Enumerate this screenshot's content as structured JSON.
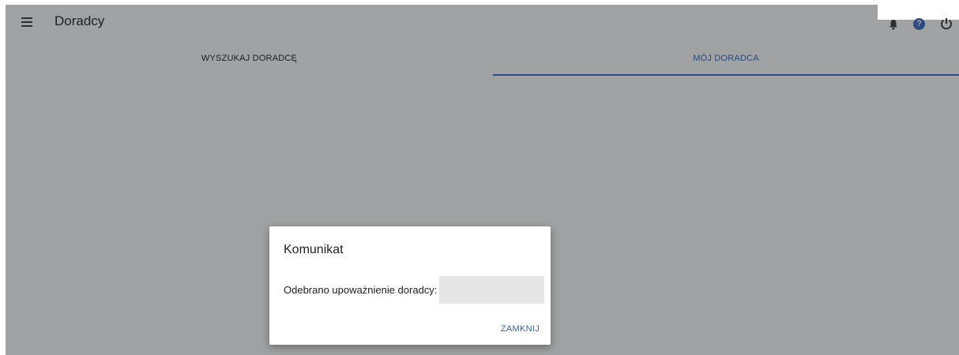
{
  "appbar": {
    "title": "Doradcy",
    "icons": [
      "menu-icon",
      "bell-icon",
      "help-icon",
      "power-icon"
    ]
  },
  "tabs": [
    {
      "label": "WYSZUKAJ DORADCĘ",
      "active": false
    },
    {
      "label": "MÓJ DORADCA",
      "active": true
    }
  ],
  "dialog": {
    "title": "Komunikat",
    "message": "Odebrano upoważnienie doradcy:",
    "value": "",
    "close_label": "ZAMKNIJ"
  },
  "colors": {
    "overlay_bg": "#a0a1a2",
    "accent": "#2b4f85",
    "link": "#3461b5"
  }
}
